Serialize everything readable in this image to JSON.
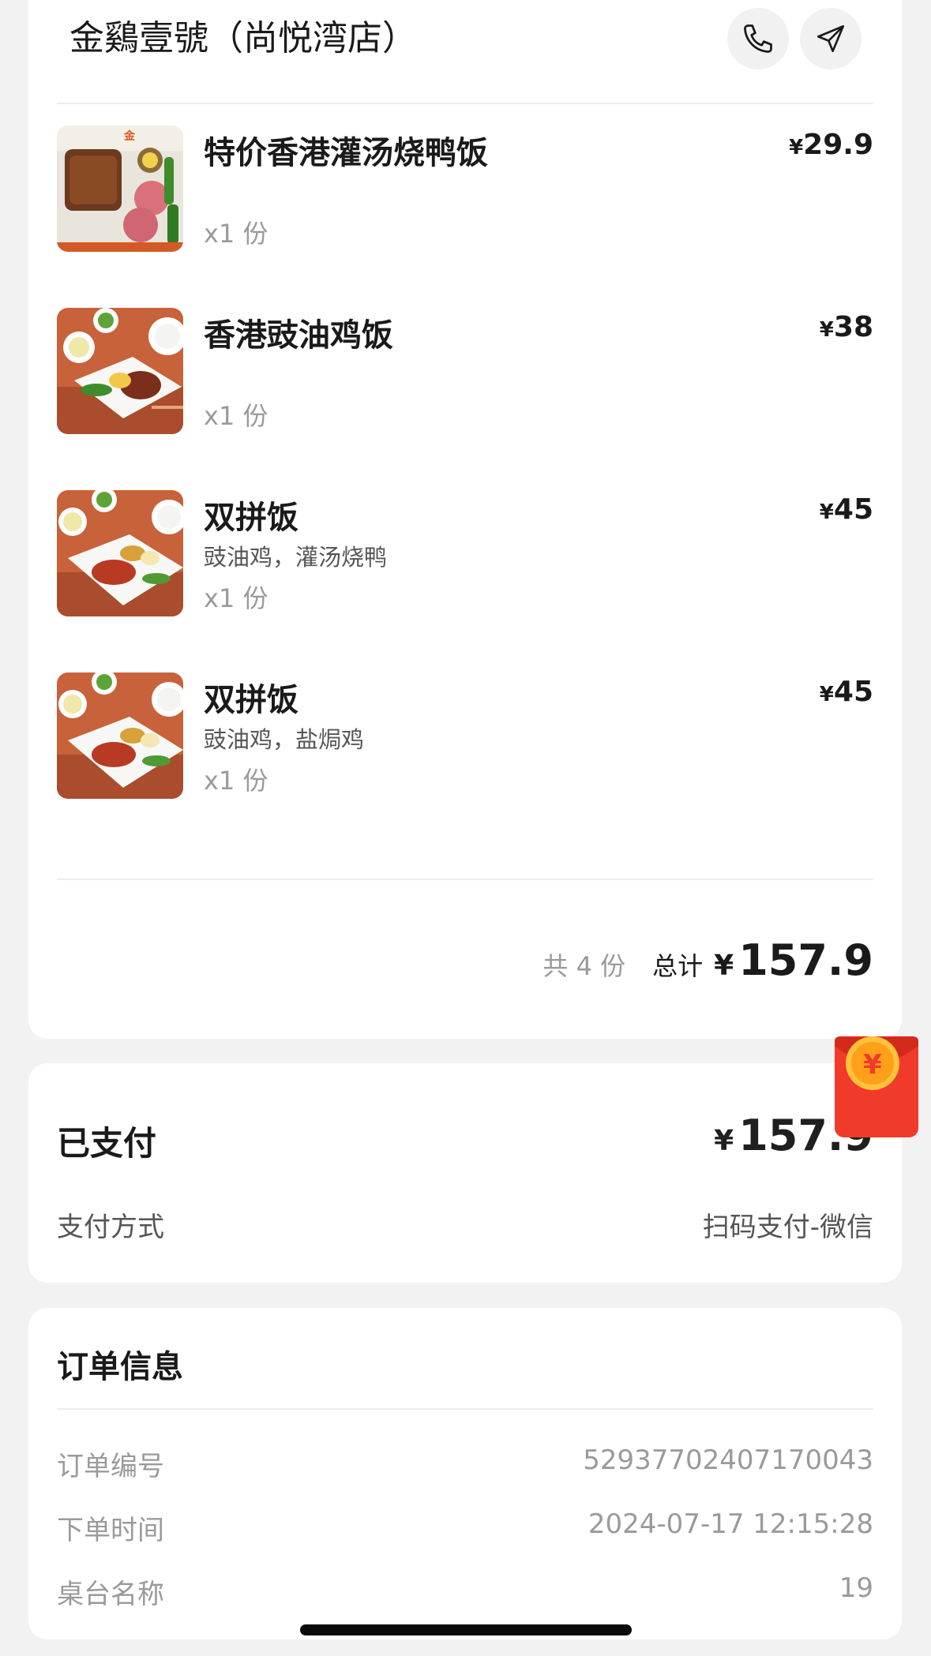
{
  "store": {
    "name": "金鷄壹號（尚悦湾店）",
    "phone_icon": "phone-icon",
    "navigate_icon": "navigation-arrow-icon"
  },
  "items": [
    {
      "name": "特价香港灌汤烧鸭饭",
      "sub": "",
      "qty": "x1 份",
      "yen": "¥",
      "price": "29.9",
      "image": "roast-duck-rice"
    },
    {
      "name": "香港豉油鸡饭",
      "sub": "",
      "qty": "x1 份",
      "yen": "¥",
      "price": "38",
      "image": "soy-sauce-chicken-rice"
    },
    {
      "name": "双拼饭",
      "sub": "豉油鸡，灌汤烧鸭",
      "qty": "x1 份",
      "yen": "¥",
      "price": "45",
      "image": "double-combo-rice"
    },
    {
      "name": "双拼饭",
      "sub": "豉油鸡，盐焗鸡",
      "qty": "x1 份",
      "yen": "¥",
      "price": "45",
      "image": "double-combo-rice"
    }
  ],
  "summary": {
    "count": "共 4 份",
    "total_label": "总计",
    "yen": "¥",
    "total": "157.9"
  },
  "payment": {
    "status": "已支付",
    "yen": "¥",
    "amount": "157.9",
    "method_label": "支付方式",
    "method_value": "扫码支付-微信"
  },
  "order_info": {
    "title": "订单信息",
    "rows": [
      {
        "label": "订单编号",
        "value": "52937702407170043"
      },
      {
        "label": "下单时间",
        "value": "2024-07-17 12:15:28"
      },
      {
        "label": "桌台名称",
        "value": "19"
      }
    ]
  },
  "colors": {
    "background": "#f2f2f2",
    "card": "#ffffff",
    "red_packet": "#f03a2a",
    "coin": "#ffb300"
  }
}
